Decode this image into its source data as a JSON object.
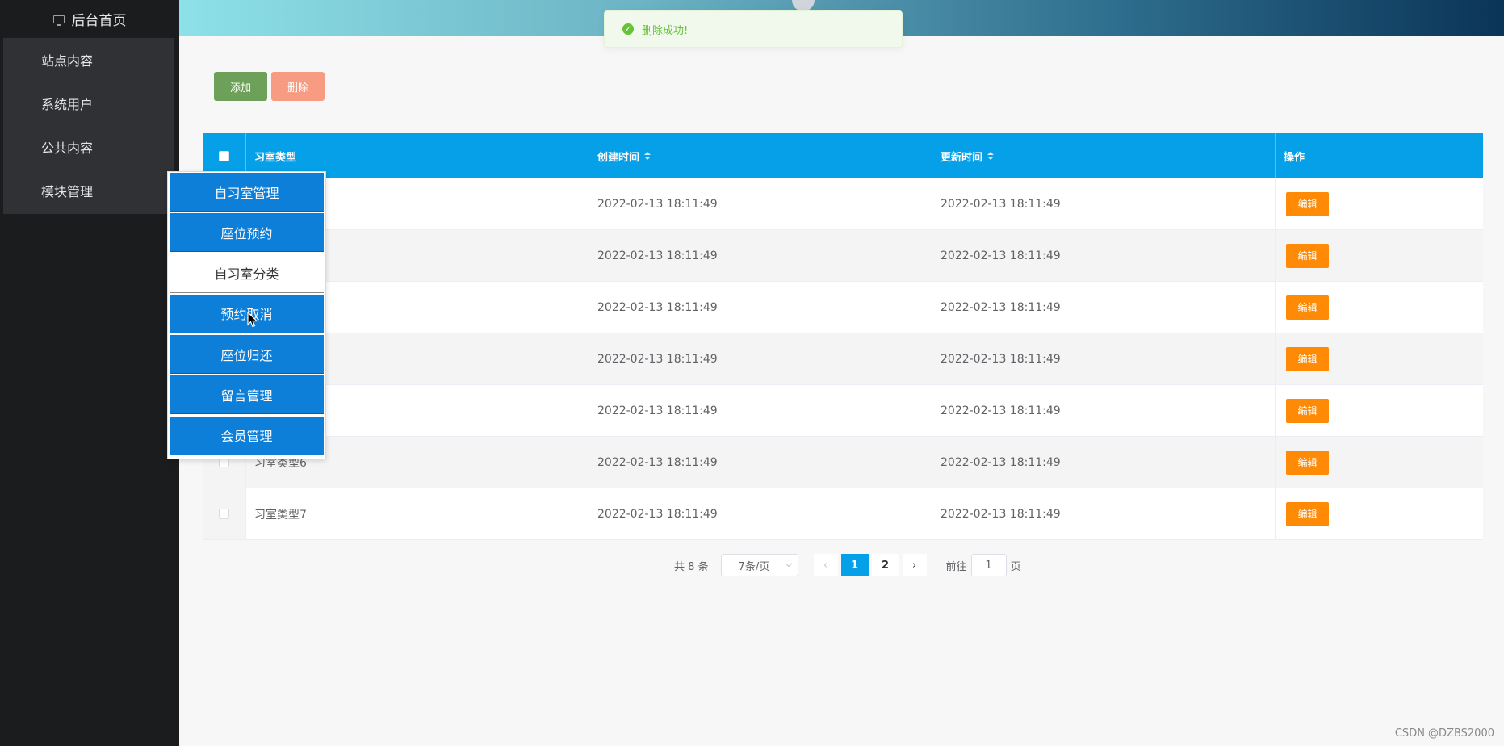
{
  "sidebar": {
    "home_label": "后台首页",
    "items": [
      {
        "label": "站点内容"
      },
      {
        "label": "系统用户"
      },
      {
        "label": "公共内容"
      },
      {
        "label": "模块管理"
      }
    ]
  },
  "submenu": {
    "items": [
      {
        "label": "自习室管理",
        "active": false
      },
      {
        "label": "座位预约",
        "active": false
      },
      {
        "label": "自习室分类",
        "active": true
      },
      {
        "label": "预约取消",
        "active": false
      },
      {
        "label": "座位归还",
        "active": false
      },
      {
        "label": "留言管理",
        "active": false
      },
      {
        "label": "会员管理",
        "active": false
      }
    ]
  },
  "toast": {
    "message": "删除成功!"
  },
  "toolbar": {
    "add_label": "添加",
    "delete_label": "删除"
  },
  "table": {
    "headers": {
      "type": "习室类型",
      "created": "创建时间",
      "updated": "更新时间",
      "op": "操作"
    },
    "rows": [
      {
        "type": "",
        "created": "2022-02-13 18:11:49",
        "updated": "2022-02-13 18:11:49",
        "edit": "编辑"
      },
      {
        "type": "",
        "created": "2022-02-13 18:11:49",
        "updated": "2022-02-13 18:11:49",
        "edit": "编辑"
      },
      {
        "type": "",
        "created": "2022-02-13 18:11:49",
        "updated": "2022-02-13 18:11:49",
        "edit": "编辑"
      },
      {
        "type": "",
        "created": "2022-02-13 18:11:49",
        "updated": "2022-02-13 18:11:49",
        "edit": "编辑"
      },
      {
        "type": "",
        "created": "2022-02-13 18:11:49",
        "updated": "2022-02-13 18:11:49",
        "edit": "编辑"
      },
      {
        "type": "习室类型6",
        "created": "2022-02-13 18:11:49",
        "updated": "2022-02-13 18:11:49",
        "edit": "编辑"
      },
      {
        "type": "习室类型7",
        "created": "2022-02-13 18:11:49",
        "updated": "2022-02-13 18:11:49",
        "edit": "编辑"
      }
    ]
  },
  "pagination": {
    "total": "共 8 条",
    "page_size": "7条/页",
    "pages": [
      "1",
      "2"
    ],
    "current": "1",
    "goto_label": "前往",
    "goto_value": "1",
    "page_unit": "页"
  },
  "watermark": "CSDN @DZBS2000",
  "colors": {
    "accent": "#05a0e8",
    "submenu": "#0d7fd9",
    "edit": "#ff8a05",
    "add": "#6da058",
    "delete": "#f89b83",
    "success": "#67c23a"
  }
}
